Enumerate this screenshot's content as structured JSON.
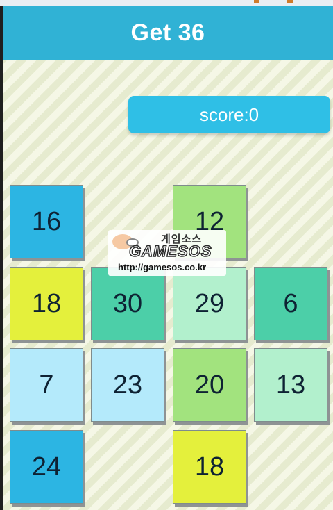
{
  "header": {
    "title": "Get 36"
  },
  "score": {
    "label": "score:0"
  },
  "board": {
    "tiles": [
      {
        "value": "16",
        "color": "#2cb5e3"
      },
      {
        "value": "12",
        "color": "#a2e37e"
      },
      {
        "value": "18",
        "color": "#e4f03c"
      },
      {
        "value": "30",
        "color": "#4ccfa8"
      },
      {
        "value": "29",
        "color": "#b2f0cd"
      },
      {
        "value": "6",
        "color": "#4ccfa8"
      },
      {
        "value": "7",
        "color": "#b4eafb"
      },
      {
        "value": "23",
        "color": "#b4eafb"
      },
      {
        "value": "20",
        "color": "#a2e37e"
      },
      {
        "value": "13",
        "color": "#b2f0cd"
      },
      {
        "value": "24",
        "color": "#2cb5e3"
      },
      {
        "value": "18",
        "color": "#e4f03c"
      }
    ]
  },
  "watermark": {
    "korean_text": "게임소스",
    "logo_text": "GAMESOS",
    "url": "http://gamesos.co.kr"
  }
}
